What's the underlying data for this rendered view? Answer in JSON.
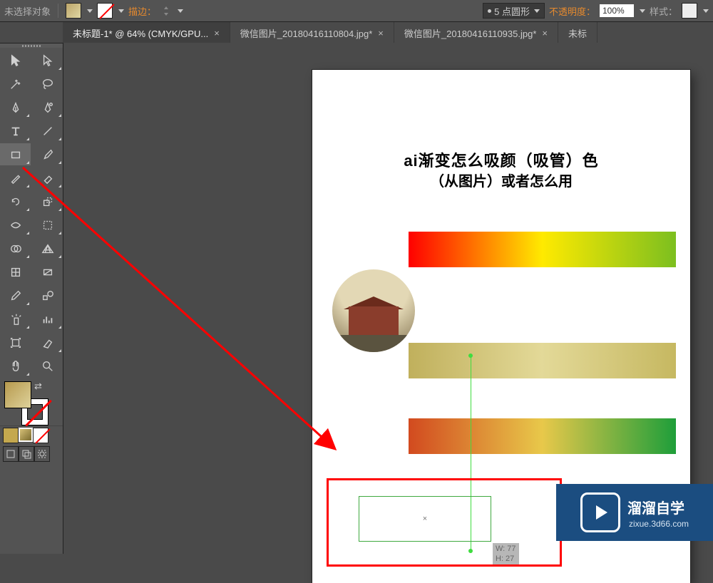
{
  "control_bar": {
    "no_selection": "未选择对象",
    "stroke_label": "描边：",
    "stroke_weight_text": "5 点圆形",
    "opacity_label": "不透明度：",
    "opacity_value": "100%",
    "style_label": "样式："
  },
  "tabs": [
    {
      "label": "未标题-1* @ 64% (CMYK/GPU...",
      "close": "×",
      "active": true
    },
    {
      "label": "微信图片_20180416110804.jpg*",
      "close": "×",
      "active": false
    },
    {
      "label": "微信图片_20180416110935.jpg*",
      "close": "×",
      "active": false
    },
    {
      "label": "未标",
      "close": "",
      "active": false
    }
  ],
  "artwork": {
    "title_line1": "ai渐变怎么吸颜（吸管）色",
    "title_line2": "（从图片）或者怎么用",
    "dim_w": "W: 77",
    "dim_h": "H: 27",
    "center_mark": "×"
  },
  "badge": {
    "brand": "溜溜自学",
    "url": "zixue.3d66.com"
  },
  "icons": {
    "selection": "selection",
    "direct": "direct-selection",
    "wand": "magic-wand",
    "lasso": "lasso",
    "pen": "pen",
    "curvature": "curvature-pen",
    "type": "type",
    "line": "line-segment",
    "rect": "rectangle",
    "brush": "paintbrush",
    "pencil": "pencil",
    "eraser": "eraser",
    "rotate": "rotate",
    "scale": "scale",
    "width": "width",
    "warp": "free-transform",
    "shapebuilder": "shape-builder",
    "perspective": "perspective-grid",
    "mesh": "mesh",
    "gradient": "gradient",
    "eyedrop": "eyedropper",
    "measure": "blend",
    "symbol": "symbol-sprayer",
    "graph": "column-graph",
    "artboard": "artboard",
    "slice": "slice",
    "hand": "hand",
    "zoom": "zoom"
  }
}
